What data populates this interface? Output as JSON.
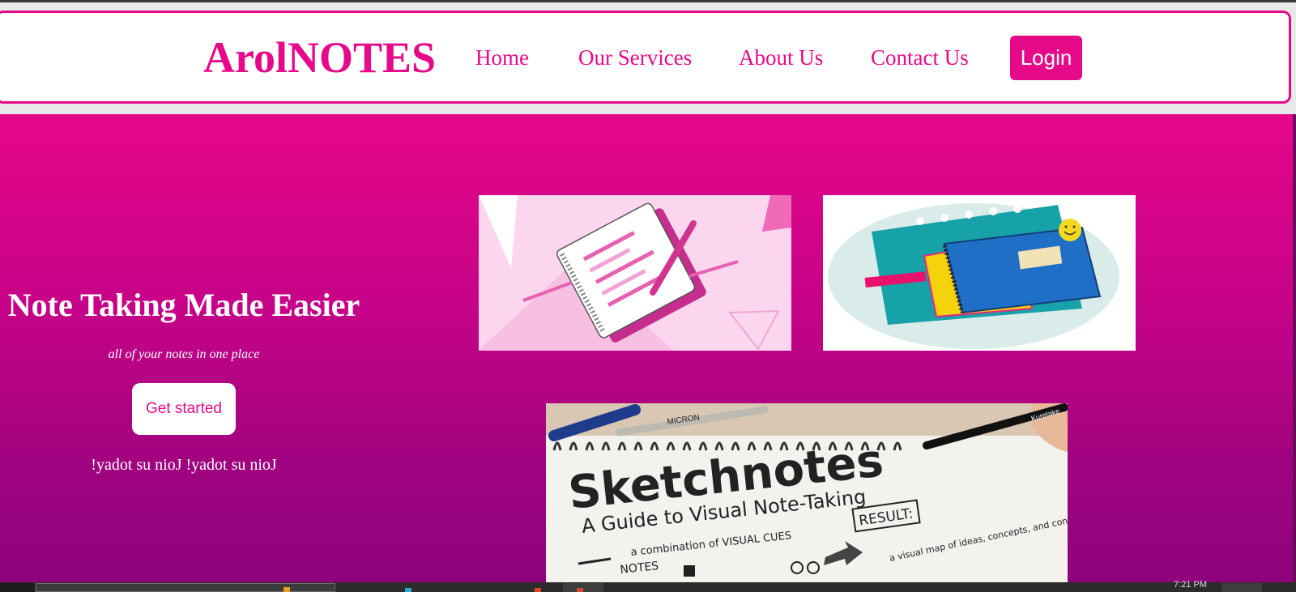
{
  "brand": "ArolNOTES",
  "nav": {
    "links": [
      "Home",
      "Our Services",
      "About Us",
      "Contact Us"
    ],
    "login_label": "Login"
  },
  "hero": {
    "title": "Note Taking Made Easier",
    "subtitle": "all of your notes in one place",
    "cta_label": "Get started",
    "tagline": "!yadot su nioJ !yadot su nioJ"
  },
  "images": {
    "sketch_title": "Sketchnotes",
    "sketch_subtitle": "A Guide to Visual Note-Taking",
    "sketch_cues": "a combination of VISUAL CUES",
    "sketch_notes": "NOTES",
    "sketch_result": "RESULT:",
    "sketch_map": "a visual map of ideas, concepts, and connections!",
    "brush_brand": "Kuretake",
    "pen_brand": "MICRON"
  },
  "taskbar": {
    "clock": "7:21 PM"
  },
  "colors": {
    "accent": "#e60a8a",
    "hero_top": "#e6068a",
    "hero_bottom": "#8e037c"
  }
}
